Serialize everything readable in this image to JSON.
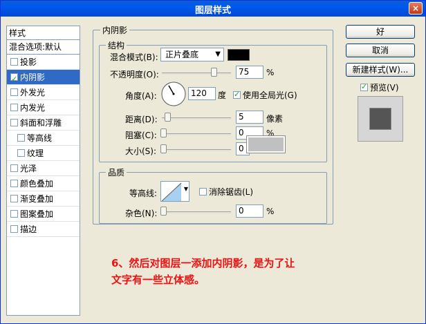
{
  "window": {
    "title": "图层样式",
    "close_label": "×"
  },
  "styles_panel": {
    "header": "样式",
    "blend_options": "混合选项:默认",
    "items": [
      {
        "label": "投影",
        "checked": false,
        "sub": false,
        "selected": false
      },
      {
        "label": "内阴影",
        "checked": true,
        "sub": false,
        "selected": true
      },
      {
        "label": "外发光",
        "checked": false,
        "sub": false,
        "selected": false
      },
      {
        "label": "内发光",
        "checked": false,
        "sub": false,
        "selected": false
      },
      {
        "label": "斜面和浮雕",
        "checked": false,
        "sub": false,
        "selected": false
      },
      {
        "label": "等高线",
        "checked": false,
        "sub": true,
        "selected": false
      },
      {
        "label": "纹理",
        "checked": false,
        "sub": true,
        "selected": false
      },
      {
        "label": "光泽",
        "checked": false,
        "sub": false,
        "selected": false
      },
      {
        "label": "颜色叠加",
        "checked": false,
        "sub": false,
        "selected": false
      },
      {
        "label": "渐变叠加",
        "checked": false,
        "sub": false,
        "selected": false
      },
      {
        "label": "图案叠加",
        "checked": false,
        "sub": false,
        "selected": false
      },
      {
        "label": "描边",
        "checked": false,
        "sub": false,
        "selected": false
      }
    ]
  },
  "inner_shadow": {
    "title": "内阴影",
    "structure": {
      "title": "结构",
      "blend_mode_label": "混合模式(B):",
      "blend_mode_value": "正片叠底",
      "shadow_color": "#000000",
      "opacity_label": "不透明度(O):",
      "opacity_value": "75",
      "opacity_unit": "%",
      "opacity_level": 0.75,
      "angle_label": "角度(A):",
      "angle_value": "120",
      "angle_unit": "度",
      "global_light_label": "使用全局光(G)",
      "global_light_checked": true,
      "distance_label": "距离(D):",
      "distance_value": "5",
      "distance_unit": "像素",
      "distance_level": 0.02,
      "choke_label": "阻塞(C):",
      "choke_value": "0",
      "choke_unit": "%",
      "size_label": "大小(S):",
      "size_value": "0",
      "size_unit": ""
    },
    "quality": {
      "title": "品质",
      "contour_label": "等高线:",
      "antialias_label": "消除锯齿(L)",
      "antialias_checked": false,
      "noise_label": "杂色(N):",
      "noise_value": "0",
      "noise_unit": "%"
    }
  },
  "buttons": {
    "ok": "好",
    "cancel": "取消",
    "new_style": "新建样式(W)...",
    "preview_label": "预览(V)",
    "preview_checked": true
  },
  "annotation": {
    "line1": "6、然后对图层一添加内阴影，是为了让",
    "line2": "文字有一些立体感。"
  }
}
